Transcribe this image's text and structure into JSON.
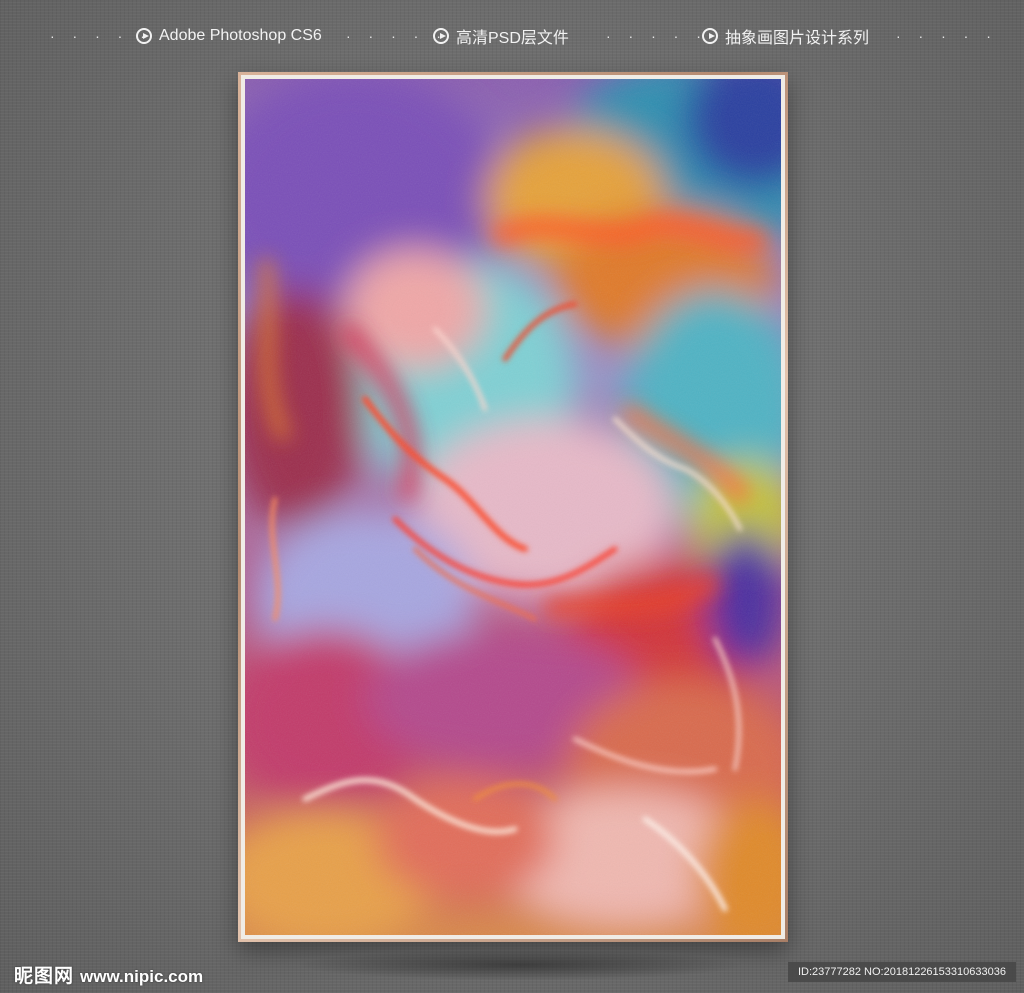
{
  "header": {
    "item1": "Adobe Photoshop CS6",
    "item2": "高清PSD层文件",
    "item3": "抽象画图片设计系列",
    "dots": "· · · · ·",
    "icon": "play-circle-icon"
  },
  "watermark": {
    "logo": "昵图网",
    "url": "www.nipic.com",
    "id_text": "ID:23777282 NO:20181226153310633036"
  },
  "colors": {
    "background": "#6e6e6e",
    "frame": "#c9a088",
    "text": "#f2f2f2"
  }
}
